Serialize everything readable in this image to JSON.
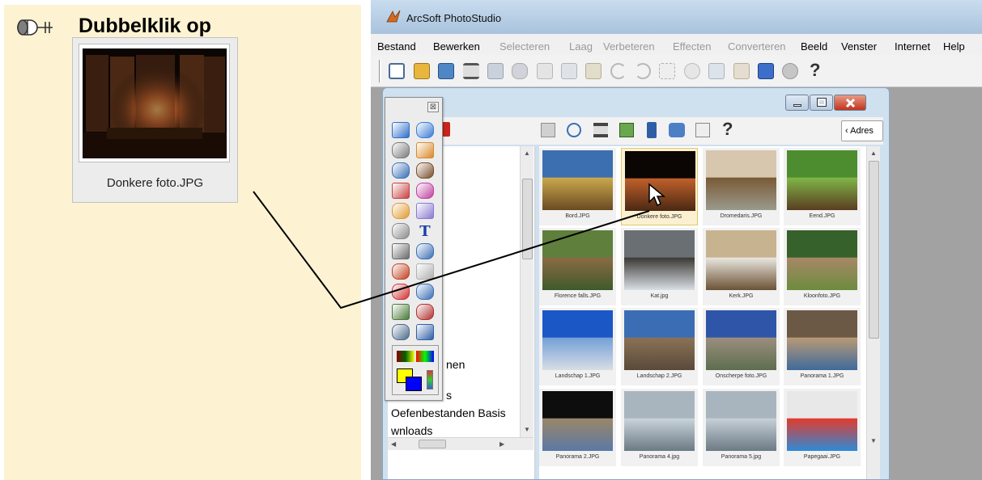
{
  "instruction": {
    "title": "Dubbelklik op",
    "icon": "mouse-double-click-icon",
    "file_caption": "Donkere foto.JPG"
  },
  "app": {
    "title": "ArcSoft PhotoStudio",
    "logo_icon": "arcsoft-logo-icon",
    "menu": [
      {
        "label": "Bestand",
        "enabled": true
      },
      {
        "label": "Bewerken",
        "enabled": true
      },
      {
        "label": "Selecteren",
        "enabled": false
      },
      {
        "label": "Laag",
        "enabled": false
      },
      {
        "label": "Verbeteren",
        "enabled": false
      },
      {
        "label": "Effecten",
        "enabled": false
      },
      {
        "label": "Converteren",
        "enabled": false
      },
      {
        "label": "Beeld",
        "enabled": true
      },
      {
        "label": "Venster",
        "enabled": true
      },
      {
        "label": "Internet",
        "enabled": true
      },
      {
        "label": "Help",
        "enabled": true
      }
    ],
    "toolbar_icons": [
      "new-icon",
      "open-icon",
      "acquire-icon",
      "print-icon",
      "save-icon",
      "print-preview-icon",
      "crop-icon",
      "copy-icon",
      "paste-icon",
      "undo-icon",
      "redo-icon",
      "magic-wand-icon",
      "effect-icon",
      "adjust-icon",
      "resize-icon",
      "album-icon",
      "slideshow-icon",
      "help-icon"
    ],
    "help_glyph": "?"
  },
  "browser": {
    "address_label": "Adres",
    "address_arrow": "‹",
    "toolbar_icons": [
      "import-icon",
      "zoom-icon",
      "print-icon",
      "rename-icon",
      "delete-icon",
      "printer-icon",
      "send-icon",
      "help-icon"
    ],
    "folder_items": [
      "nen",
      "s",
      "Oefenbestanden Basis",
      "wnloads"
    ],
    "thumbnails": [
      {
        "label": "Bord.JPG",
        "selected": false
      },
      {
        "label": "Donkere foto.JPG",
        "selected": true
      },
      {
        "label": "Dromedaris.JPG",
        "selected": false
      },
      {
        "label": "Eend.JPG",
        "selected": false
      },
      {
        "label": "Florence falls.JPG",
        "selected": false
      },
      {
        "label": "Kat.jpg",
        "selected": false
      },
      {
        "label": "Kerk.JPG",
        "selected": false
      },
      {
        "label": "Kloonfoto.JPG",
        "selected": false
      },
      {
        "label": "Landschap 1.JPG",
        "selected": false
      },
      {
        "label": "Landschap 2.JPG",
        "selected": false
      },
      {
        "label": "Onscherpe foto.JPG",
        "selected": false
      },
      {
        "label": "Panorama 1.JPG",
        "selected": false
      },
      {
        "label": "Panorama 2.JPG",
        "selected": false
      },
      {
        "label": "Panorama 4.jpg",
        "selected": false
      },
      {
        "label": "Panorama 5.jpg",
        "selected": false
      },
      {
        "label": "Papegaai.JPG",
        "selected": false
      }
    ]
  },
  "palette": {
    "close_glyph": "⊠",
    "text_tool_glyph": "T",
    "tools": [
      "rect-select-icon",
      "move-icon",
      "lasso-icon",
      "pen-icon",
      "zoom-tool-icon",
      "red-eye-icon",
      "brush-icon",
      "eraser-icon",
      "smudge-icon",
      "clone-icon",
      "fill-icon",
      "text-tool-icon",
      "dodge-icon",
      "shape-icon",
      "stamp-icon",
      "retouch-icon",
      "line-icon",
      "pencil-icon",
      "transform-icon",
      "eyedropper-icon",
      "frame-icon",
      "trash-icon"
    ]
  },
  "colors": {
    "instruction_bg": "#fdf3d3",
    "selection": "#e2c572"
  }
}
